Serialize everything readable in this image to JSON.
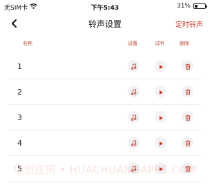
{
  "status_bar": {
    "carrier": "无SIM卡",
    "wifi_icon": "wifi-icon",
    "time": "下午5:43",
    "battery_text": "31%",
    "battery_level": 0.31
  },
  "nav": {
    "title": "铃声设置",
    "action_label": "定时铃声",
    "back_icon": "chevron-left-icon"
  },
  "table": {
    "headers": {
      "name": "名称",
      "set": "设置",
      "listen": "试听",
      "delete": "删除"
    },
    "rows": [
      {
        "label": "1"
      },
      {
        "label": "2"
      },
      {
        "label": "3"
      },
      {
        "label": "4"
      },
      {
        "label": "5"
      }
    ]
  },
  "watermark": "华创应用 • HUACHUANGAPPS.COM",
  "colors": {
    "accent": "#c0392b",
    "header_text": "#b84a3a",
    "icon_bg": "#f2f2f4",
    "divider": "#eeeeee"
  }
}
